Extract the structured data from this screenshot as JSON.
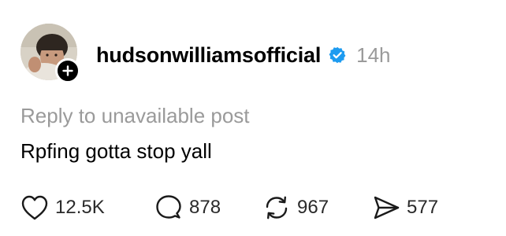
{
  "post": {
    "username": "hudsonwilliamsofficial",
    "verified": true,
    "timestamp": "14h",
    "reply_context": "Reply to unavailable post",
    "text": "Rpfing gotta stop yall"
  },
  "actions": {
    "likes": "12.5K",
    "replies": "878",
    "reposts": "967",
    "shares": "577"
  },
  "colors": {
    "verified_badge": "#1d9bf0",
    "muted_text": "#9a9a9a",
    "primary_text": "#000000"
  },
  "icons": {
    "like": "heart-icon",
    "reply": "speech-bubble-icon",
    "repost": "repost-arrows-icon",
    "share": "paper-plane-icon",
    "follow": "plus-icon",
    "verified": "verified-check-icon"
  }
}
